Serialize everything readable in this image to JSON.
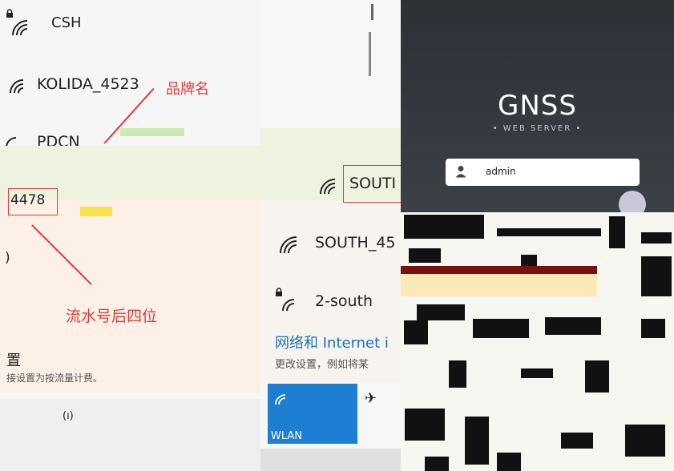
{
  "left_panel": {
    "networks": [
      {
        "name": "CSH",
        "secured": true
      },
      {
        "name": "KOLIDA_4523",
        "secured": false
      },
      {
        "name": "PDCN",
        "secured": false
      }
    ],
    "serial_box_text": "4478",
    "annotation_brand": "品牌名",
    "annotation_serial": "流水号后四位",
    "settings_title": "置",
    "settings_desc": "接设置为按流量计费。"
  },
  "mid_panel": {
    "networks": [
      {
        "name": "SOUTI",
        "secured": false
      },
      {
        "name": "SOUTH_45",
        "secured": false
      },
      {
        "name": "2-south",
        "secured": true
      }
    ],
    "settings_title": "网络和 Internet i",
    "settings_desc": "更改设置，例如将某",
    "wlan_label": "WLAN"
  },
  "right_panel": {
    "app_title": "GNSS",
    "app_subtitle": "• WEB SERVER •",
    "username_value": "admin"
  },
  "colors": {
    "accent_red": "#e53935",
    "tile_blue": "#1c7fd1",
    "login_bg": "#2f3439"
  },
  "icons": [
    "wifi-icon",
    "lock-icon",
    "user-icon",
    "airplane-icon",
    "hotspot-icon"
  ]
}
